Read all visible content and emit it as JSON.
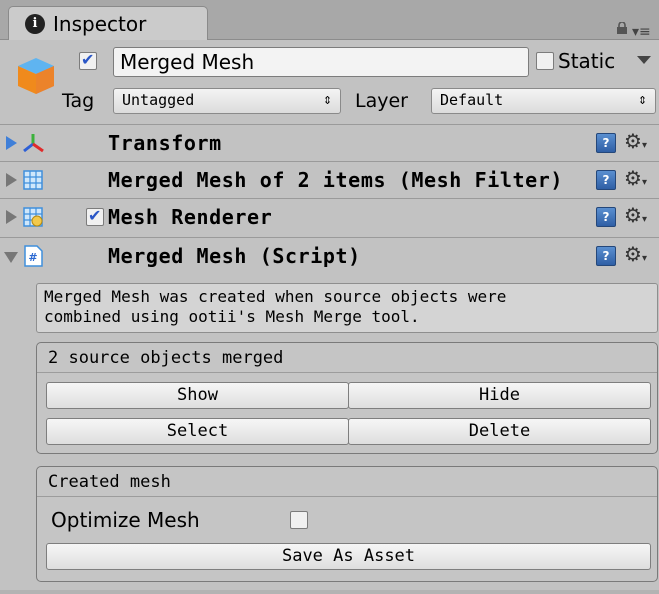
{
  "tab": {
    "title": "Inspector",
    "info_glyph": "i"
  },
  "header": {
    "active_checked": true,
    "object_name": "Merged Mesh",
    "static_label": "Static",
    "static_checked": false,
    "tag_label": "Tag",
    "tag_value": "Untagged",
    "layer_label": "Layer",
    "layer_value": "Default"
  },
  "components": [
    {
      "label": "Transform",
      "expanded": false,
      "icon": "transform-axes-icon"
    },
    {
      "label": "Merged Mesh of 2 items (Mesh Filter)",
      "expanded": false,
      "icon": "mesh-filter-icon"
    },
    {
      "label": "Mesh Renderer",
      "expanded": false,
      "icon": "mesh-renderer-icon",
      "enabled": true
    },
    {
      "label": "Merged Mesh (Script)",
      "expanded": true,
      "icon": "csharp-script-icon"
    }
  ],
  "script": {
    "help_text_line1": "Merged Mesh was created when source objects were",
    "help_text_line2": "combined using ootii's Mesh Merge tool.",
    "source_group": {
      "title": "2 source objects merged",
      "buttons": {
        "show": "Show",
        "hide": "Hide",
        "select": "Select",
        "delete": "Delete"
      }
    },
    "mesh_group": {
      "title": "Created mesh",
      "optimize_label": "Optimize Mesh",
      "optimize_checked": false,
      "save_button": "Save As Asset"
    }
  },
  "colors": {
    "accent_blue": "#2a56c6",
    "help_blue": "#3f7fd8",
    "panel_bg": "#c2c2c2"
  }
}
